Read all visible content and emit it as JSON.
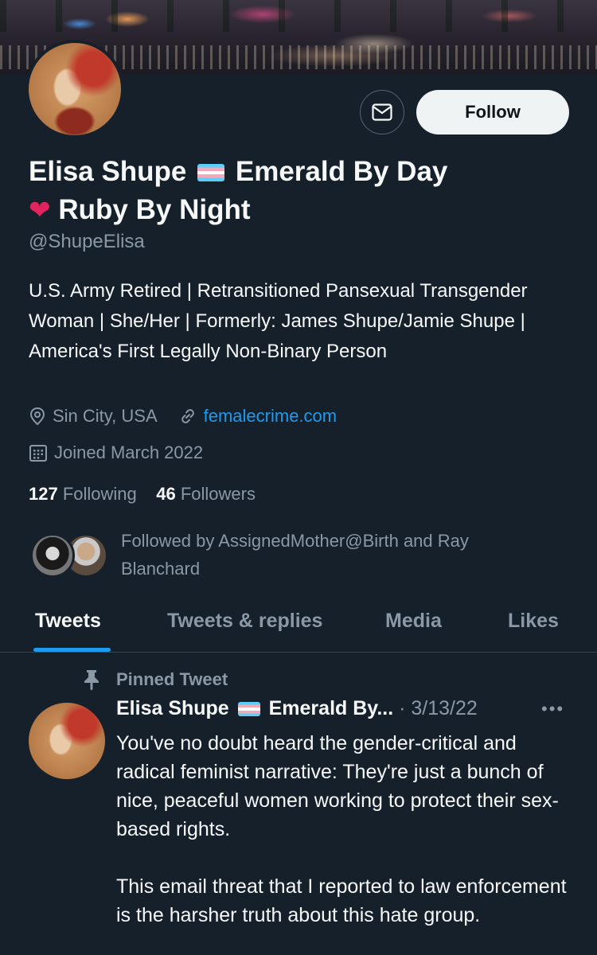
{
  "profile": {
    "display_name_line1_a": "Elisa Shupe",
    "display_name_line1_b": "Emerald By Day",
    "display_name_line2": "Ruby By Night",
    "handle": "@ShupeElisa",
    "bio": "U.S. Army Retired | Retransitioned Pansexual Transgender Woman | She/Her | Formerly: James Shupe/Jamie Shupe | America's First Legally Non-Binary Person",
    "location": "Sin City, USA",
    "website": "femalecrime.com",
    "joined": "Joined March 2022",
    "following_count": "127",
    "following_label": "Following",
    "followers_count": "46",
    "followers_label": "Followers",
    "followed_by": "Followed by AssignedMother@Birth and Ray Blanchard"
  },
  "actions": {
    "follow_label": "Follow",
    "message_icon": "envelope-icon"
  },
  "tabs": [
    {
      "label": "Tweets",
      "active": true
    },
    {
      "label": "Tweets & replies",
      "active": false
    },
    {
      "label": "Media",
      "active": false
    },
    {
      "label": "Likes",
      "active": false
    }
  ],
  "pinned_tweet": {
    "pinned_label": "Pinned Tweet",
    "author_a": "Elisa Shupe",
    "author_b": "Emerald By...",
    "date": "· 3/13/22",
    "more": "•••",
    "paragraph1": "You've no doubt heard the gender-critical and radical feminist narrative: They're just a bunch of nice, peaceful women working to protect their sex-based rights.",
    "paragraph2": "This email threat that I reported to law enforcement is the harsher truth about this hate group."
  },
  "colors": {
    "background": "#15202b",
    "accent": "#1d9bf0",
    "secondary_text": "#8b98a5"
  }
}
